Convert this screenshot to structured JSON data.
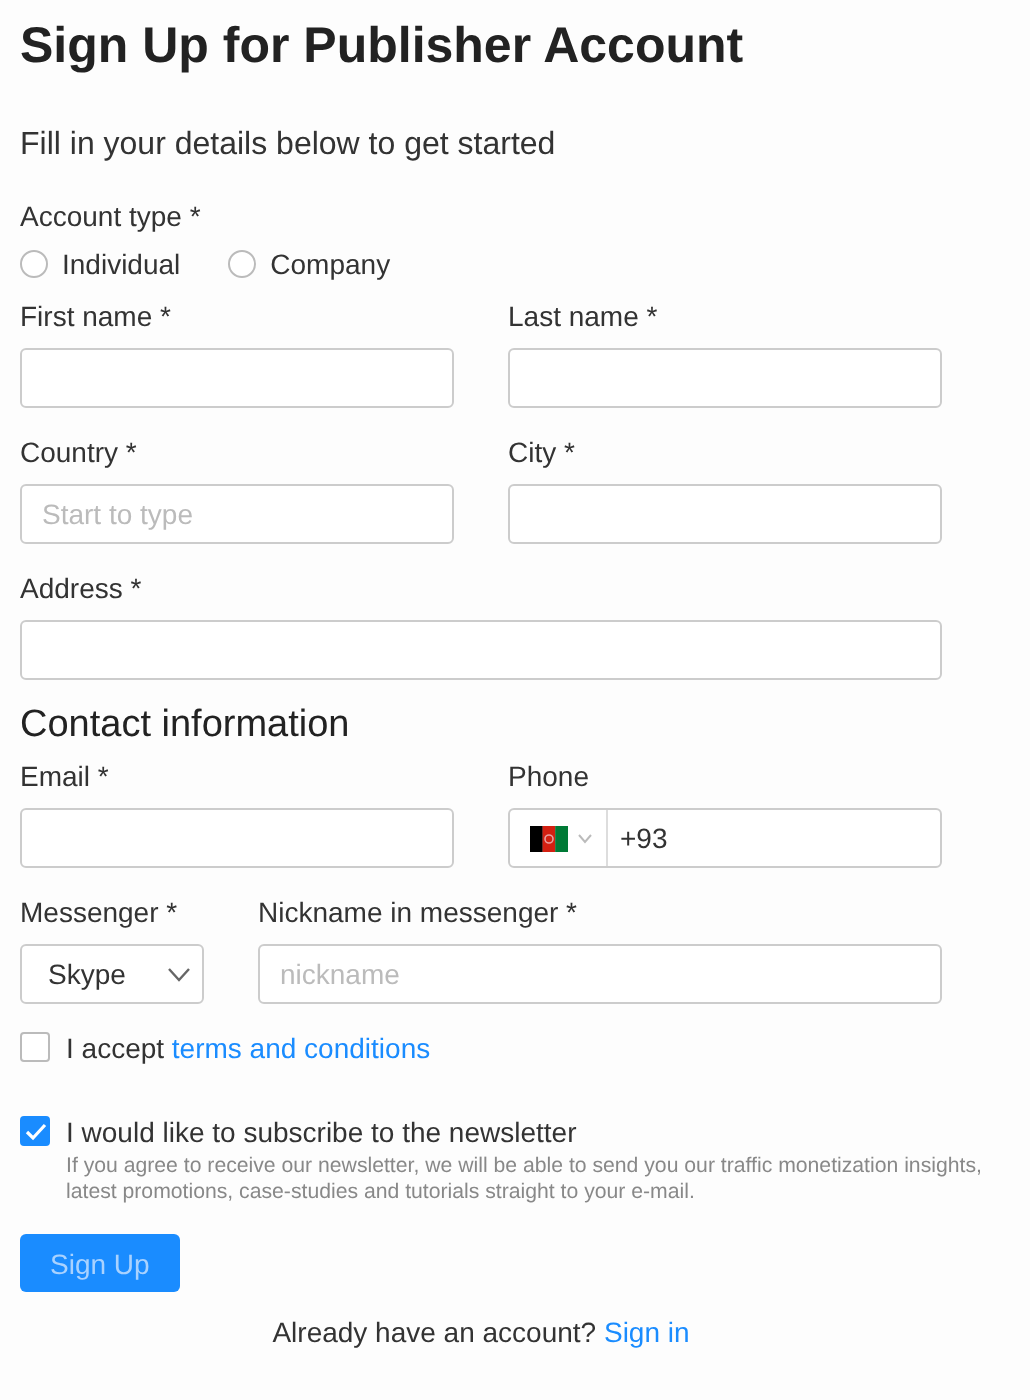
{
  "title": "Sign Up for Publisher Account",
  "subtitle": "Fill in your details below to get started",
  "account_type": {
    "label": "Account type *",
    "options": [
      {
        "label": "Individual",
        "selected": false
      },
      {
        "label": "Company",
        "selected": false
      }
    ]
  },
  "rows": [
    {
      "fields": [
        {
          "kind": "text",
          "label": "First name *"
        },
        {
          "kind": "text",
          "label": "Last name *"
        }
      ]
    },
    {
      "fields": [
        {
          "kind": "text",
          "label": "Country *",
          "placeholder": "Start to type"
        },
        {
          "kind": "text",
          "label": "City *"
        }
      ]
    },
    {
      "fields": [
        {
          "kind": "text",
          "label": "Address *"
        }
      ]
    },
    {
      "heading": "Contact information"
    },
    {
      "fields": [
        {
          "kind": "text",
          "label": "Email *"
        },
        {
          "kind": "phone",
          "label": "Phone",
          "value": "+93"
        }
      ]
    },
    {
      "fields": [
        {
          "kind": "select",
          "label": "Messenger *",
          "value": "Skype"
        },
        {
          "kind": "text",
          "label": "Nickname in messenger *",
          "placeholder": "nickname"
        }
      ]
    }
  ],
  "terms": {
    "checked": false,
    "text": "I accept",
    "link": "terms and conditions"
  },
  "newsletter": {
    "checked": true,
    "text": "I would like to subscribe to the newsletter",
    "description": "If you agree to receive our newsletter, we will be able to send you our traffic monetization insights, latest promotions, case-studies and tutorials straight to your e-mail."
  },
  "submit": {
    "label": "Sign Up",
    "disabled": true
  },
  "signin": {
    "text": "Already have an account?",
    "link": "Sign in"
  }
}
